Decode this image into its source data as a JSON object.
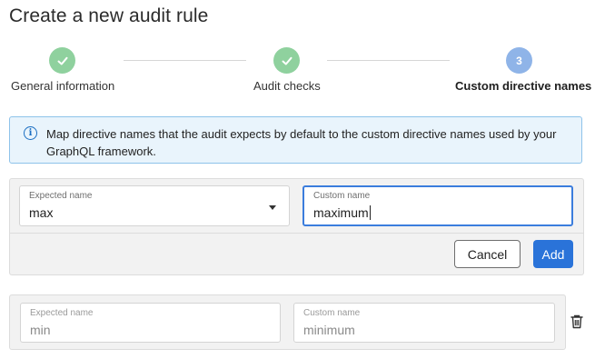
{
  "page": {
    "title": "Create a new audit rule"
  },
  "stepper": {
    "steps": [
      {
        "label": "General information",
        "state": "done",
        "icon": "check-icon"
      },
      {
        "label": "Audit checks",
        "state": "done",
        "icon": "check-icon"
      },
      {
        "label": "Custom directive names",
        "state": "active",
        "number": "3"
      }
    ]
  },
  "info_banner": {
    "icon": "info-icon",
    "text": "Map directive names that the audit expects by default to the custom directive names used by your GraphQL framework."
  },
  "mappings": [
    {
      "expected_label": "Expected name",
      "expected_value": "max",
      "custom_label": "Custom name",
      "custom_value": "maximum",
      "editing": true
    },
    {
      "expected_label": "Expected name",
      "expected_value": "min",
      "custom_label": "Custom name",
      "custom_value": "minimum",
      "editing": false
    }
  ],
  "actions": {
    "cancel_label": "Cancel",
    "add_label": "Add"
  },
  "colors": {
    "step_done": "#8fd19e",
    "step_active": "#8fb4e8",
    "banner_bg": "#e9f4fc",
    "banner_border": "#8ec3ea",
    "primary": "#2a73d9",
    "focus_border": "#3b7ddd"
  }
}
